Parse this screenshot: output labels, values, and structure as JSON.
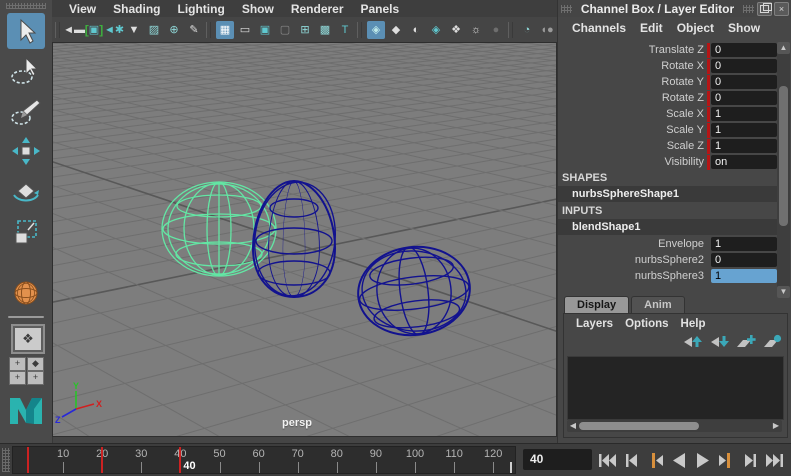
{
  "colors": {
    "selected_wireframe": "#63e6a4",
    "unselected_wireframe": "#12128f",
    "keyed_channel_red": "#b51515",
    "timeline_key_red": "#cc2222",
    "playback_key_orange": "#d78f3c",
    "selection_blue": "#5b8fb4",
    "maya_teal": "#2ab3af"
  },
  "viewport_menu": {
    "items": [
      "View",
      "Shading",
      "Lighting",
      "Show",
      "Renderer",
      "Panels"
    ]
  },
  "viewport_toolbar": {
    "icons": [
      {
        "name": "separator"
      },
      {
        "name": "select-camera-icon",
        "glyph": "◄▬"
      },
      {
        "name": "lock-camera-icon",
        "glyph": "▣",
        "bracketed": true,
        "tint": "#5fc8cf"
      },
      {
        "name": "camera-attributes-icon",
        "glyph": "◄✱",
        "tint": "#5fc8cf"
      },
      {
        "name": "bookmark-icon",
        "glyph": "▼"
      },
      {
        "name": "image-plane-icon",
        "glyph": "▨",
        "tint": "#8fd8d8"
      },
      {
        "name": "pan-zoom-icon",
        "glyph": "⊕",
        "tint": "#8fd8d8"
      },
      {
        "name": "grease-pencil-icon",
        "glyph": "✎"
      },
      {
        "name": "separator"
      },
      {
        "name": "grid-icon",
        "glyph": "▦",
        "active": true
      },
      {
        "name": "film-gate-icon",
        "glyph": "▭"
      },
      {
        "name": "resolution-gate-icon",
        "glyph": "▣",
        "tint": "#5fc8cf"
      },
      {
        "name": "gate-mask-icon",
        "glyph": "▢",
        "tint": "#8a8a8a"
      },
      {
        "name": "field-chart-icon",
        "glyph": "⊞",
        "tint": "#8fd8d8"
      },
      {
        "name": "safe-action-icon",
        "glyph": "▩",
        "tint": "#8fd8d8"
      },
      {
        "name": "safe-title-icon",
        "glyph": "T",
        "tint": "#5fc8cf"
      },
      {
        "name": "separator"
      },
      {
        "name": "wireframe-display-icon",
        "glyph": "◈",
        "active": true,
        "tint": "#bfeaea"
      },
      {
        "name": "shaded-display-icon",
        "glyph": "◆"
      },
      {
        "name": "textured-display-icon",
        "glyph": "◐"
      },
      {
        "name": "wireframe-on-shaded-icon",
        "glyph": "◈",
        "tint": "#5fc8cf"
      },
      {
        "name": "default-material-icon",
        "glyph": "❖"
      },
      {
        "name": "lights-icon",
        "glyph": "☼"
      },
      {
        "name": "shadows-icon",
        "glyph": "●",
        "tint": "#6e6e6e"
      },
      {
        "name": "separator"
      },
      {
        "name": "xray-icon",
        "glyph": "◔",
        "tint": "#8fd8d8"
      },
      {
        "name": "exposure-icon",
        "glyph": "◖●",
        "tint": "#9a9a9a"
      }
    ]
  },
  "toolbox": {
    "tools": [
      {
        "name": "select-tool",
        "active": true
      },
      {
        "name": "lasso-tool"
      },
      {
        "name": "paint-selection-tool"
      },
      {
        "name": "move-tool"
      },
      {
        "name": "rotate-tool"
      },
      {
        "name": "scale-tool"
      }
    ],
    "history_tool": "sphere-history",
    "layout_shortcuts": [
      "single-pane-layout",
      "pane-layout-a",
      "pane-layout-b",
      "pane-layout-c",
      "pane-layout-d"
    ]
  },
  "viewport": {
    "camera_label": "persp"
  },
  "channel_box": {
    "title": "Channel Box / Layer Editor",
    "menu": [
      "Channels",
      "Edit",
      "Object",
      "Show"
    ],
    "channels": [
      {
        "label": "Translate Z",
        "value": "0"
      },
      {
        "label": "Rotate X",
        "value": "0"
      },
      {
        "label": "Rotate Y",
        "value": "0"
      },
      {
        "label": "Rotate Z",
        "value": "0"
      },
      {
        "label": "Scale X",
        "value": "1"
      },
      {
        "label": "Scale Y",
        "value": "1"
      },
      {
        "label": "Scale Z",
        "value": "1"
      },
      {
        "label": "Visibility",
        "value": "on"
      }
    ],
    "shapes_header": "SHAPES",
    "shape_node": "nurbsSphereShape1",
    "inputs_header": "INPUTS",
    "input_node": "blendShape1",
    "input_channels": [
      {
        "label": "Envelope",
        "value": "1",
        "selected": false
      },
      {
        "label": "nurbsSphere2",
        "value": "0",
        "selected": false
      },
      {
        "label": "nurbsSphere3",
        "value": "1",
        "selected": true
      }
    ]
  },
  "layer_editor": {
    "tabs": [
      {
        "label": "Display",
        "active": true
      },
      {
        "label": "Anim",
        "active": false
      }
    ],
    "menu": [
      "Layers",
      "Options",
      "Help"
    ],
    "icons": [
      "move-layer-up",
      "move-layer-down",
      "new-empty-layer",
      "new-layer-with-selected"
    ]
  },
  "timeline": {
    "tick_labels": [
      10,
      20,
      30,
      40,
      50,
      60,
      70,
      80,
      90,
      100,
      110,
      120
    ],
    "key_frames": [
      1,
      20
    ],
    "current_frame": 40,
    "current_frame_label": "40",
    "current_time_field": "40"
  },
  "playback": {
    "buttons": [
      "go-to-start",
      "step-back-frame",
      "step-back-key",
      "play-backwards",
      "play-forwards",
      "step-forward-key",
      "step-forward-frame",
      "go-to-end"
    ]
  }
}
